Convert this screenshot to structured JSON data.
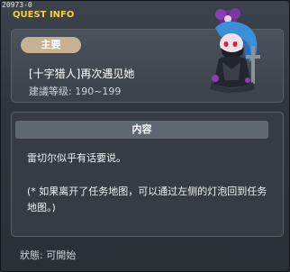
{
  "window": {
    "quest_id": "20973-0",
    "title": "QUEST INFO"
  },
  "quest": {
    "category": "主要",
    "name": "[十字猎人]再次遇见她",
    "level": "建議等级: 190~199"
  },
  "content": {
    "header": "内容",
    "line1": "雷切尔似乎有话要说。",
    "line2": "(* 如果离开了任务地图，可以通过左侧的灯泡回到任务地图。)"
  },
  "status": {
    "text": "狀態: 可開始"
  },
  "colors": {
    "title": "#f3d23c",
    "badge": "#c7b193",
    "panel": "#3b4149"
  },
  "icons": {
    "portrait": "npc-portrait-icon"
  }
}
